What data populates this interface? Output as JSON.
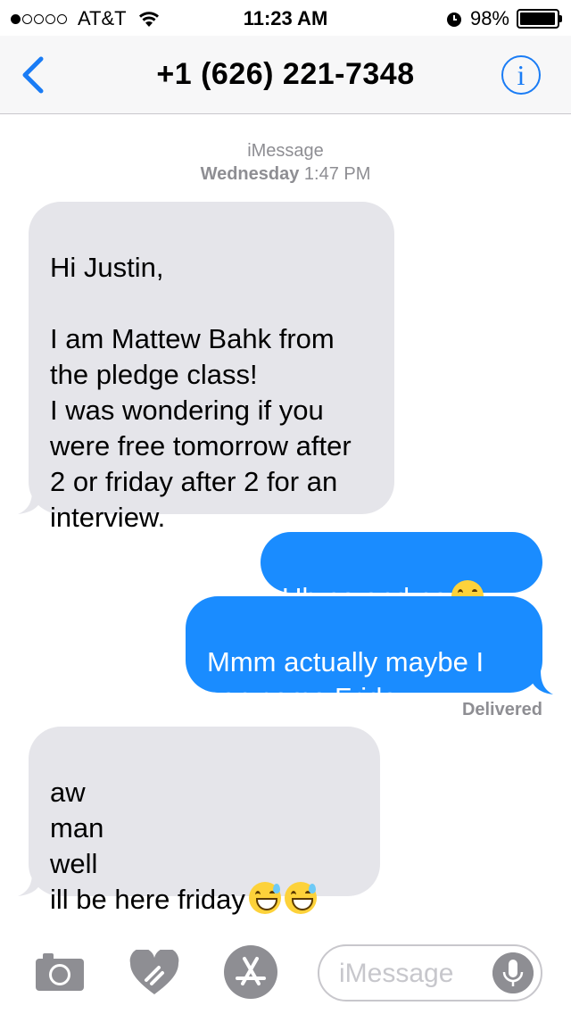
{
  "status_bar": {
    "carrier": "AT&T",
    "signal_bars_filled": 1,
    "signal_bars_total": 5,
    "time": "11:23 AM",
    "battery_percent": "98%",
    "battery_level": 0.98,
    "icons": [
      "wifi-icon",
      "alarm-icon",
      "battery-icon"
    ]
  },
  "nav": {
    "title": "+1 (626) 221-7348",
    "back_icon": "chevron-left-icon",
    "info_label": "i",
    "accent_color": "#1a7cf5"
  },
  "conversation": {
    "service": "iMessage",
    "day": "Wednesday",
    "time": "1:47 PM",
    "messages": [
      {
        "direction": "incoming",
        "text": "Hi Justin,\n\nI am Mattew Bahk from the pledge class!\nI was wondering if you were free tomorrow after 2 or friday after 2 for an interview."
      },
      {
        "direction": "outgoing",
        "text": "Uh no and no",
        "emoji": [
          "face-with-tears-of-joy"
        ]
      },
      {
        "direction": "outgoing",
        "text": "Mmm actually maybe I can come Friday"
      },
      {
        "direction": "incoming",
        "text": "aw\nman\nwell\nill be here friday",
        "emoji": [
          "grinning-face-with-sweat",
          "grinning-face-with-sweat"
        ]
      }
    ],
    "delivered_label": "Delivered",
    "incoming_color": "#e5e5ea",
    "outgoing_color": "#1a8cff"
  },
  "toolbar": {
    "icons": [
      "camera-icon",
      "digital-touch-heart-icon",
      "app-store-icon",
      "microphone-icon"
    ],
    "input_placeholder": "iMessage"
  }
}
